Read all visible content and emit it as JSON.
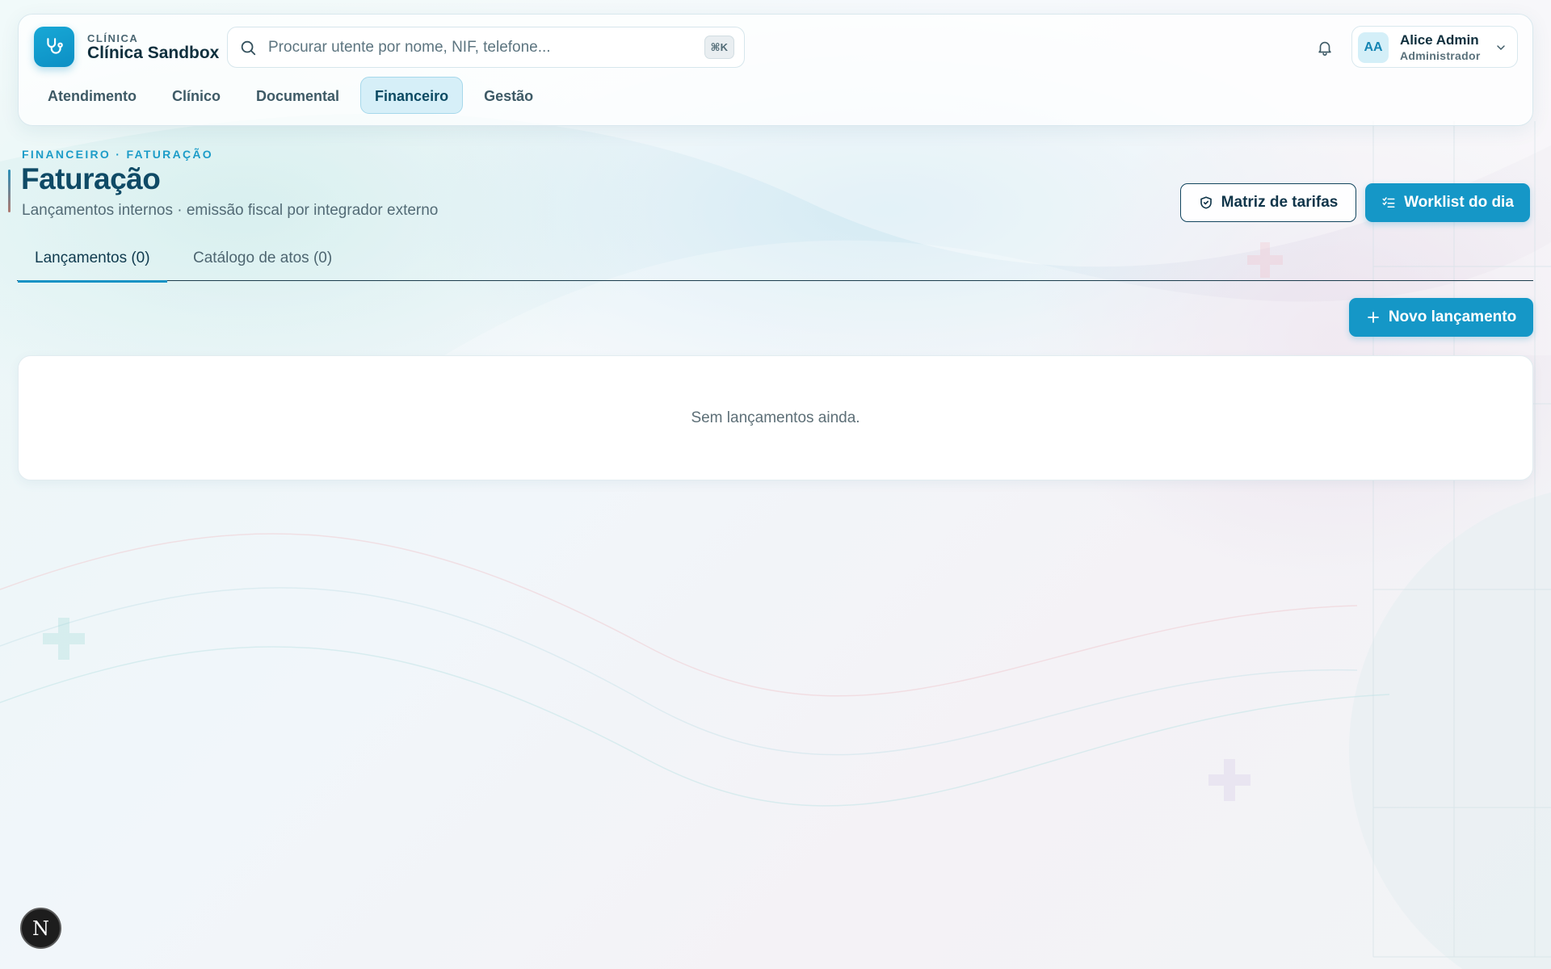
{
  "brand": {
    "kicker": "CLÍNICA",
    "name": "Clínica Sandbox"
  },
  "search": {
    "placeholder": "Procurar utente por nome, NIF, telefone...",
    "shortcut": "⌘K"
  },
  "user": {
    "initials": "AA",
    "name": "Alice Admin",
    "role": "Administrador"
  },
  "nav": {
    "items": [
      {
        "label": "Atendimento"
      },
      {
        "label": "Clínico"
      },
      {
        "label": "Documental"
      },
      {
        "label": "Financeiro"
      },
      {
        "label": "Gestão"
      }
    ],
    "active": "Financeiro"
  },
  "page": {
    "breadcrumb": "FINANCEIRO · FATURAÇÃO",
    "title": "Faturação",
    "subtitle": "Lançamentos internos · emissão fiscal por integrador externo"
  },
  "actions": {
    "tariff_matrix": "Matriz de tarifas",
    "worklist": "Worklist do dia",
    "new_entry": "Novo lançamento"
  },
  "tabs": [
    {
      "label": "Lançamentos (0)"
    },
    {
      "label": "Catálogo de atos (0)"
    }
  ],
  "empty_state": "Sem lançamentos ainda.",
  "dev_badge": "N",
  "colors": {
    "primary": "#1597c7",
    "title": "#0f4a66",
    "accent_text": "#1c9cc8"
  }
}
